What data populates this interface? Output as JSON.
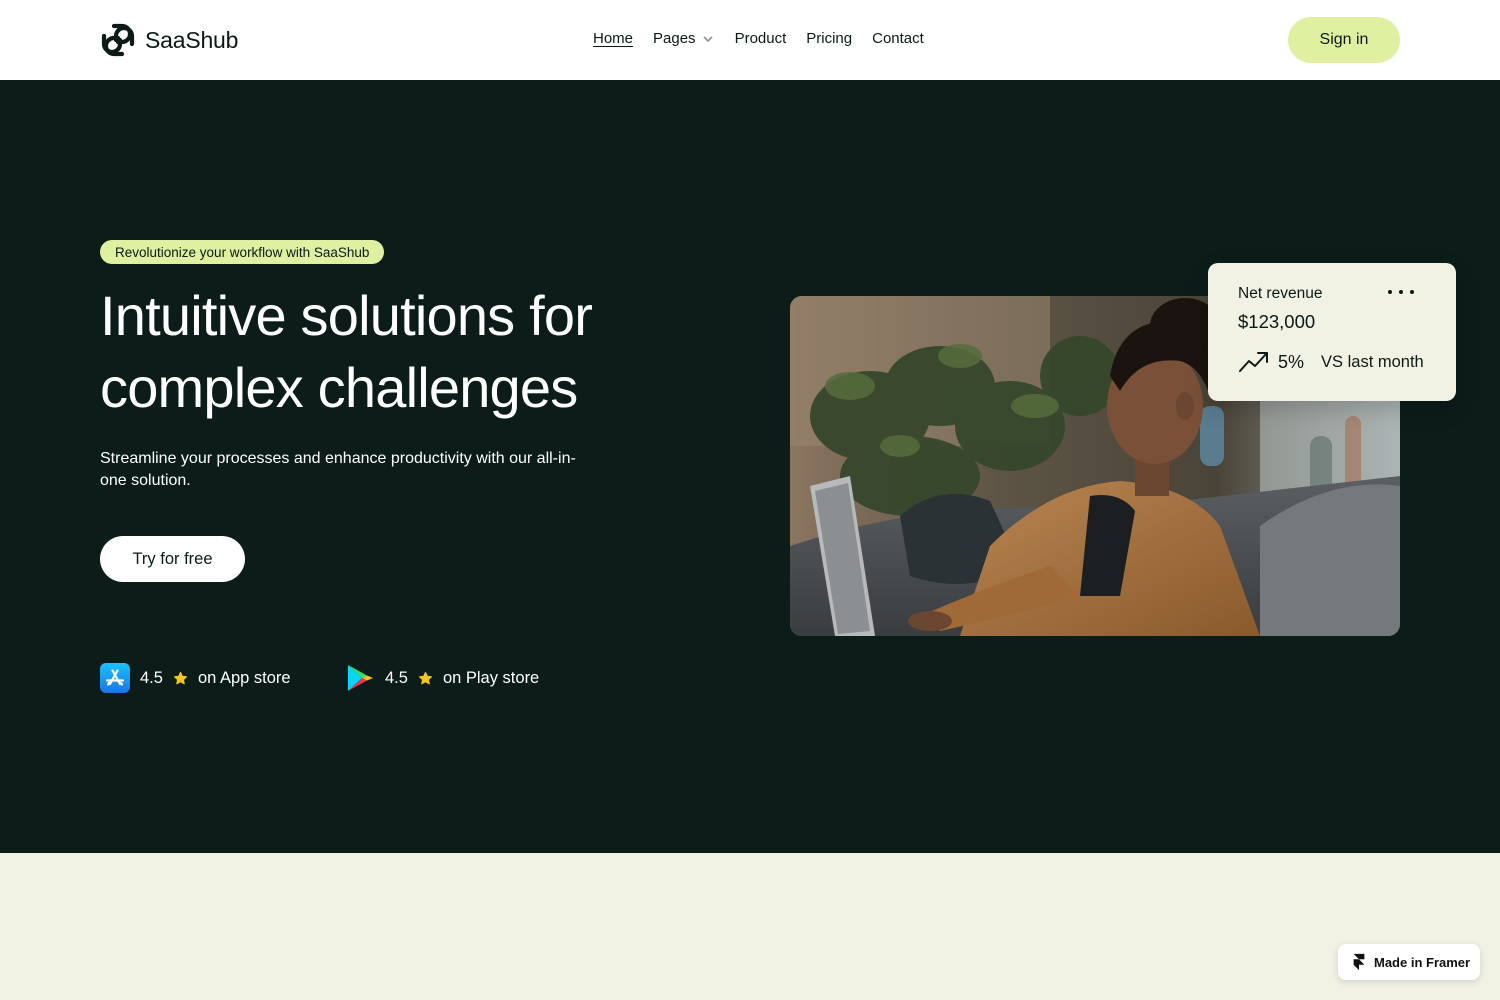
{
  "brand": {
    "name": "SaaShub",
    "icon": "knot-logo-icon"
  },
  "nav": {
    "home": "Home",
    "pages": "Pages",
    "product": "Product",
    "pricing": "Pricing",
    "contact": "Contact"
  },
  "header": {
    "signin_label": "Sign in"
  },
  "hero": {
    "badge": "Revolutionize your workflow with SaaShub",
    "title_line1": "Intuitive solutions for",
    "title_line2": "complex challenges",
    "subtitle": "Streamline your processes and enhance productivity with our all-in-one solution.",
    "cta_label": "Try for free",
    "ratings": [
      {
        "score": "4.5",
        "label": "on App store",
        "icon": "app-store-icon"
      },
      {
        "score": "4.5",
        "label": "on Play store",
        "icon": "play-store-icon"
      }
    ]
  },
  "revenue_card": {
    "label": "Net revenue",
    "amount": "$123,000",
    "change": "5%",
    "comparison": "VS last month",
    "icon": "trend-up-icon"
  },
  "framer_badge": {
    "label": "Made in Framer"
  },
  "colors": {
    "hero_bg": "#0b1c19",
    "accent": "#dff1a0",
    "page_bg": "#f1f1e4",
    "text_dark": "#0b1a17"
  }
}
